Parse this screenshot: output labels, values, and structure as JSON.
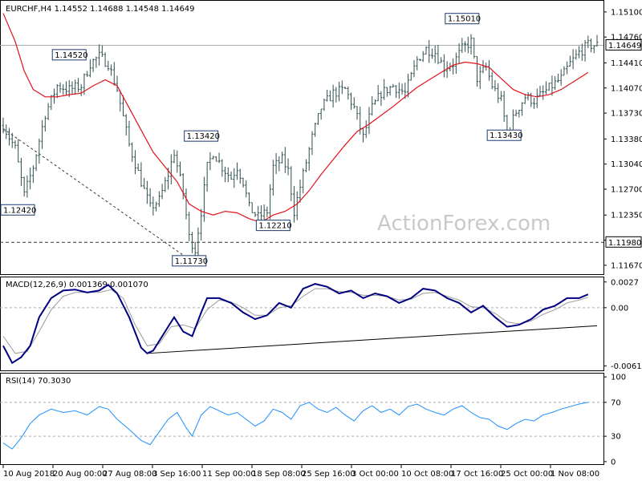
{
  "chart_data": [
    {
      "type": "candlestick",
      "title": "EURCHF,H4  1.14552 1.14688 1.14548 1.14649",
      "watermark": "ActionForex.com",
      "ylim": [
        1.1156,
        1.1524
      ],
      "y_ticks": [
        1.151,
        1.1476,
        1.1441,
        1.1407,
        1.1373,
        1.1338,
        1.1304,
        1.127,
        1.1235,
        1.1201,
        1.1167
      ],
      "y_tick_labels": [
        "1.15100",
        "1.14760",
        "1.14410",
        "1.14070",
        "1.13730",
        "1.13380",
        "1.13040",
        "1.12700",
        "1.12350",
        "",
        "1.11670"
      ],
      "current_price": 1.14649,
      "current_price_label": "1.14649",
      "hline": 1.1198,
      "hline_label": "1.11980",
      "x_labels": [
        "10 Aug 2018",
        "20 Aug 00:00",
        "27 Aug 08:00",
        "3 Sep 16:00",
        "11 Sep 00:00",
        "18 Sep 08:00",
        "25 Sep 16:00",
        "3 Oct 00:00",
        "10 Oct 08:00",
        "17 Oct 16:00",
        "25 Oct 00:00",
        "1 Nov 08:00"
      ],
      "annotations": [
        {
          "text": "1.12420",
          "x": 0.5,
          "y": 1.1242
        },
        {
          "text": "1.14520",
          "x": 22,
          "y": 1.1452
        },
        {
          "text": "1.11730",
          "x": 62,
          "y": 1.1173
        },
        {
          "text": "1.13420",
          "x": 66,
          "y": 1.1342
        },
        {
          "text": "1.12210",
          "x": 90,
          "y": 1.1221
        },
        {
          "text": "1.15010",
          "x": 153,
          "y": 1.1501
        },
        {
          "text": "1.13430",
          "x": 167,
          "y": 1.1343
        }
      ],
      "price_path": [
        [
          0,
          1.1356
        ],
        [
          4,
          1.1325
        ],
        [
          7,
          1.1262
        ],
        [
          10,
          1.13
        ],
        [
          14,
          1.1372
        ],
        [
          18,
          1.141
        ],
        [
          22,
          1.1405
        ],
        [
          26,
          1.141
        ],
        [
          29,
          1.144
        ],
        [
          32,
          1.145
        ],
        [
          35,
          1.144
        ],
        [
          38,
          1.1405
        ],
        [
          42,
          1.133
        ],
        [
          46,
          1.128
        ],
        [
          49,
          1.1245
        ],
        [
          52,
          1.1255
        ],
        [
          55,
          1.129
        ],
        [
          57,
          1.132
        ],
        [
          60,
          1.1265
        ],
        [
          62,
          1.1205
        ],
        [
          64,
          1.1188
        ],
        [
          66,
          1.124
        ],
        [
          68,
          1.13
        ],
        [
          70,
          1.132
        ],
        [
          73,
          1.13
        ],
        [
          76,
          1.1285
        ],
        [
          78,
          1.13
        ],
        [
          80,
          1.128
        ],
        [
          82,
          1.1245
        ],
        [
          85,
          1.1232
        ],
        [
          88,
          1.124
        ],
        [
          90,
          1.13
        ],
        [
          93,
          1.131
        ],
        [
          95,
          1.1295
        ],
        [
          97,
          1.124
        ],
        [
          100,
          1.129
        ],
        [
          103,
          1.134
        ],
        [
          106,
          1.138
        ],
        [
          110,
          1.14
        ],
        [
          114,
          1.1405
        ],
        [
          117,
          1.138
        ],
        [
          120,
          1.134
        ],
        [
          123,
          1.138
        ],
        [
          126,
          1.14
        ],
        [
          130,
          1.141
        ],
        [
          134,
          1.14
        ],
        [
          138,
          1.1445
        ],
        [
          141,
          1.146
        ],
        [
          144,
          1.1455
        ],
        [
          147,
          1.1435
        ],
        [
          150,
          1.144
        ],
        [
          153,
          1.146
        ],
        [
          156,
          1.147
        ],
        [
          158,
          1.142
        ],
        [
          161,
          1.1435
        ],
        [
          163,
          1.141
        ],
        [
          166,
          1.139
        ],
        [
          168,
          1.1345
        ],
        [
          171,
          1.1375
        ],
        [
          174,
          1.1395
        ],
        [
          177,
          1.139
        ],
        [
          180,
          1.14
        ],
        [
          183,
          1.141
        ],
        [
          186,
          1.142
        ],
        [
          189,
          1.144
        ],
        [
          192,
          1.1455
        ],
        [
          195,
          1.1465
        ]
      ],
      "ma_path": [
        [
          0,
          1.1508
        ],
        [
          4,
          1.147
        ],
        [
          7,
          1.143
        ],
        [
          10,
          1.1405
        ],
        [
          14,
          1.1395
        ],
        [
          18,
          1.1395
        ],
        [
          22,
          1.1398
        ],
        [
          26,
          1.14
        ],
        [
          30,
          1.141
        ],
        [
          34,
          1.1418
        ],
        [
          38,
          1.141
        ],
        [
          42,
          1.138
        ],
        [
          46,
          1.135
        ],
        [
          50,
          1.132
        ],
        [
          54,
          1.13
        ],
        [
          58,
          1.128
        ],
        [
          62,
          1.125
        ],
        [
          66,
          1.124
        ],
        [
          70,
          1.1235
        ],
        [
          74,
          1.124
        ],
        [
          78,
          1.1238
        ],
        [
          82,
          1.123
        ],
        [
          86,
          1.1225
        ],
        [
          90,
          1.1235
        ],
        [
          94,
          1.124
        ],
        [
          98,
          1.125
        ],
        [
          102,
          1.1268
        ],
        [
          106,
          1.129
        ],
        [
          110,
          1.131
        ],
        [
          114,
          1.133
        ],
        [
          118,
          1.1348
        ],
        [
          122,
          1.1358
        ],
        [
          126,
          1.137
        ],
        [
          130,
          1.1382
        ],
        [
          134,
          1.1395
        ],
        [
          138,
          1.1408
        ],
        [
          142,
          1.1418
        ],
        [
          146,
          1.1428
        ],
        [
          150,
          1.1438
        ],
        [
          154,
          1.1442
        ],
        [
          158,
          1.144
        ],
        [
          162,
          1.1435
        ],
        [
          166,
          1.142
        ],
        [
          170,
          1.1405
        ],
        [
          174,
          1.1398
        ],
        [
          178,
          1.1395
        ],
        [
          182,
          1.1398
        ],
        [
          186,
          1.1405
        ],
        [
          190,
          1.1415
        ],
        [
          195,
          1.1428
        ]
      ],
      "trendline": [
        [
          0,
          1.1352
        ],
        [
          62,
          1.1175
        ]
      ]
    },
    {
      "type": "line",
      "title": "MACD(12,26,9) 0.001369 0.001070",
      "ylim": [
        -0.0065,
        0.0031
      ],
      "y_ticks": [
        0.0027,
        0.0,
        -0.00611
      ],
      "y_tick_labels": [
        "0.0027",
        "0.00",
        "-0.00611"
      ],
      "macd_path": [
        [
          0,
          -0.004
        ],
        [
          3,
          -0.0058
        ],
        [
          6,
          -0.0052
        ],
        [
          9,
          -0.004
        ],
        [
          12,
          -0.001
        ],
        [
          16,
          0.001
        ],
        [
          20,
          0.0018
        ],
        [
          24,
          0.0019
        ],
        [
          28,
          0.0016
        ],
        [
          32,
          0.0018
        ],
        [
          35,
          0.0024
        ],
        [
          38,
          0.0015
        ],
        [
          42,
          -0.001
        ],
        [
          46,
          -0.0042
        ],
        [
          48,
          -0.0048
        ],
        [
          50,
          -0.0045
        ],
        [
          54,
          -0.0025
        ],
        [
          57,
          -0.001
        ],
        [
          60,
          -0.0025
        ],
        [
          63,
          -0.003
        ],
        [
          66,
          -0.0005
        ],
        [
          68,
          0.001
        ],
        [
          72,
          0.001
        ],
        [
          76,
          0.0005
        ],
        [
          80,
          -0.0005
        ],
        [
          84,
          -0.0012
        ],
        [
          88,
          -0.0008
        ],
        [
          92,
          0.0005
        ],
        [
          96,
          0.0
        ],
        [
          100,
          0.002
        ],
        [
          104,
          0.0025
        ],
        [
          108,
          0.0022
        ],
        [
          112,
          0.0015
        ],
        [
          116,
          0.0018
        ],
        [
          120,
          0.001
        ],
        [
          124,
          0.0015
        ],
        [
          128,
          0.0012
        ],
        [
          132,
          0.0005
        ],
        [
          136,
          0.001
        ],
        [
          140,
          0.002
        ],
        [
          144,
          0.0018
        ],
        [
          148,
          0.001
        ],
        [
          152,
          0.0005
        ],
        [
          156,
          -0.0005
        ],
        [
          160,
          0.0002
        ],
        [
          164,
          -0.001
        ],
        [
          168,
          -0.002
        ],
        [
          172,
          -0.0018
        ],
        [
          176,
          -0.0012
        ],
        [
          180,
          -0.0002
        ],
        [
          184,
          0.0002
        ],
        [
          188,
          0.001
        ],
        [
          192,
          0.001
        ],
        [
          195,
          0.0014
        ]
      ],
      "signal_path": [
        [
          0,
          -0.003
        ],
        [
          4,
          -0.0048
        ],
        [
          8,
          -0.0046
        ],
        [
          12,
          -0.0025
        ],
        [
          16,
          -0.0002
        ],
        [
          20,
          0.0012
        ],
        [
          24,
          0.0016
        ],
        [
          28,
          0.0016
        ],
        [
          32,
          0.0016
        ],
        [
          36,
          0.0019
        ],
        [
          40,
          0.001
        ],
        [
          44,
          -0.0018
        ],
        [
          48,
          -0.004
        ],
        [
          52,
          -0.0038
        ],
        [
          56,
          -0.002
        ],
        [
          60,
          -0.0018
        ],
        [
          64,
          -0.0022
        ],
        [
          68,
          -0.0002
        ],
        [
          72,
          0.0008
        ],
        [
          76,
          0.0006
        ],
        [
          80,
          0.0
        ],
        [
          84,
          -0.0008
        ],
        [
          88,
          -0.0008
        ],
        [
          92,
          0.0
        ],
        [
          96,
          0.0002
        ],
        [
          100,
          0.0012
        ],
        [
          104,
          0.002
        ],
        [
          108,
          0.002
        ],
        [
          112,
          0.0017
        ],
        [
          116,
          0.0016
        ],
        [
          120,
          0.0013
        ],
        [
          124,
          0.0013
        ],
        [
          128,
          0.0012
        ],
        [
          132,
          0.0008
        ],
        [
          136,
          0.0009
        ],
        [
          140,
          0.0015
        ],
        [
          144,
          0.0016
        ],
        [
          148,
          0.0012
        ],
        [
          152,
          0.0008
        ],
        [
          156,
          0.0001
        ],
        [
          160,
          0.0
        ],
        [
          164,
          -0.0006
        ],
        [
          168,
          -0.0015
        ],
        [
          172,
          -0.0017
        ],
        [
          176,
          -0.0014
        ],
        [
          180,
          -0.0007
        ],
        [
          184,
          -0.0002
        ],
        [
          188,
          0.0005
        ],
        [
          192,
          0.0008
        ],
        [
          195,
          0.0011
        ]
      ],
      "trendline": [
        [
          48,
          -0.0048
        ],
        [
          198,
          -0.0019
        ]
      ]
    },
    {
      "type": "line",
      "title": "RSI(14) 70.3030",
      "ylim": [
        -3,
        103
      ],
      "y_ticks": [
        100,
        70,
        30,
        0
      ],
      "y_tick_labels": [
        "100",
        "70",
        "30",
        "0"
      ],
      "levels": [
        70,
        30
      ],
      "values_path": [
        [
          0,
          22
        ],
        [
          3,
          15
        ],
        [
          6,
          28
        ],
        [
          9,
          45
        ],
        [
          12,
          55
        ],
        [
          16,
          62
        ],
        [
          20,
          58
        ],
        [
          24,
          60
        ],
        [
          28,
          55
        ],
        [
          32,
          65
        ],
        [
          35,
          62
        ],
        [
          38,
          50
        ],
        [
          42,
          38
        ],
        [
          46,
          25
        ],
        [
          49,
          20
        ],
        [
          52,
          35
        ],
        [
          55,
          50
        ],
        [
          58,
          58
        ],
        [
          61,
          40
        ],
        [
          63,
          30
        ],
        [
          66,
          55
        ],
        [
          69,
          65
        ],
        [
          72,
          60
        ],
        [
          75,
          55
        ],
        [
          78,
          58
        ],
        [
          81,
          50
        ],
        [
          84,
          42
        ],
        [
          87,
          48
        ],
        [
          90,
          62
        ],
        [
          93,
          58
        ],
        [
          96,
          50
        ],
        [
          99,
          66
        ],
        [
          102,
          70
        ],
        [
          105,
          62
        ],
        [
          108,
          58
        ],
        [
          111,
          64
        ],
        [
          114,
          55
        ],
        [
          117,
          48
        ],
        [
          120,
          60
        ],
        [
          123,
          66
        ],
        [
          126,
          58
        ],
        [
          129,
          62
        ],
        [
          132,
          55
        ],
        [
          135,
          65
        ],
        [
          138,
          68
        ],
        [
          141,
          62
        ],
        [
          144,
          58
        ],
        [
          147,
          55
        ],
        [
          150,
          62
        ],
        [
          153,
          66
        ],
        [
          156,
          58
        ],
        [
          159,
          52
        ],
        [
          162,
          50
        ],
        [
          165,
          42
        ],
        [
          168,
          38
        ],
        [
          171,
          45
        ],
        [
          174,
          50
        ],
        [
          177,
          48
        ],
        [
          180,
          55
        ],
        [
          183,
          58
        ],
        [
          186,
          62
        ],
        [
          189,
          65
        ],
        [
          192,
          68
        ],
        [
          195,
          70
        ]
      ]
    }
  ]
}
